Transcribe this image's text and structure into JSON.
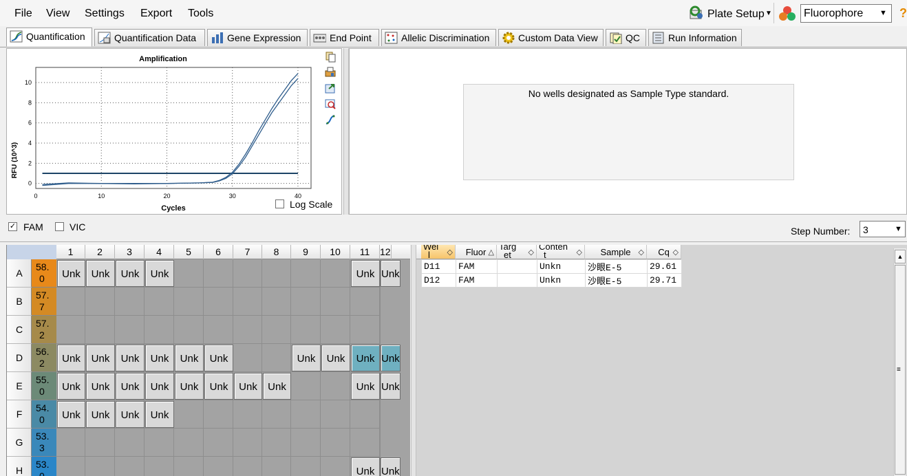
{
  "menu": [
    "File",
    "View",
    "Settings",
    "Export",
    "Tools"
  ],
  "toolbar": {
    "plate_setup": "Plate Setup",
    "fluorophore": "Fluorophore",
    "help": "?"
  },
  "tabs": [
    "Quantification",
    "Quantification Data",
    "Gene Expression",
    "End Point",
    "Allelic Discrimination",
    "Custom Data View",
    "QC",
    "Run Information"
  ],
  "std_message": "No wells designated as Sample Type standard.",
  "log_scale": "Log Scale",
  "fluors": {
    "fam": "FAM",
    "vic": "VIC"
  },
  "step": {
    "label": "Step Number:",
    "value": "3"
  },
  "plate": {
    "cols": [
      "1",
      "2",
      "3",
      "4",
      "5",
      "6",
      "7",
      "8",
      "9",
      "10",
      "11",
      "12"
    ],
    "rows": [
      "A",
      "B",
      "C",
      "D",
      "E",
      "F",
      "G",
      "H"
    ],
    "temps": [
      [
        "58.",
        "0"
      ],
      [
        "57.",
        "7"
      ],
      [
        "57.",
        "2"
      ],
      [
        "56.",
        "2"
      ],
      [
        "55.",
        "0"
      ],
      [
        "54.",
        "0"
      ],
      [
        "53.",
        "3"
      ],
      [
        "53.",
        "0"
      ]
    ],
    "temp_colors": [
      "#e8891a",
      "#d48a24",
      "#a68a4a",
      "#8c8a62",
      "#6c8a78",
      "#4a8aa6",
      "#3a88ba",
      "#2a86c8"
    ],
    "unk_label": "Unk",
    "wells": [
      [
        1,
        1,
        1,
        1,
        0,
        0,
        0,
        0,
        0,
        0,
        1,
        1
      ],
      [
        0,
        0,
        0,
        0,
        0,
        0,
        0,
        0,
        0,
        0,
        0,
        0
      ],
      [
        0,
        0,
        0,
        0,
        0,
        0,
        0,
        0,
        0,
        0,
        0,
        0
      ],
      [
        1,
        1,
        1,
        1,
        1,
        1,
        0,
        0,
        1,
        1,
        2,
        2
      ],
      [
        1,
        1,
        1,
        1,
        1,
        1,
        1,
        1,
        0,
        0,
        1,
        1
      ],
      [
        1,
        1,
        1,
        1,
        0,
        0,
        0,
        0,
        0,
        0,
        0,
        0
      ],
      [
        0,
        0,
        0,
        0,
        0,
        0,
        0,
        0,
        0,
        0,
        0,
        0
      ],
      [
        0,
        0,
        0,
        0,
        0,
        0,
        0,
        0,
        0,
        0,
        1,
        1
      ]
    ]
  },
  "results": {
    "headers": [
      [
        "Wel",
        "l"
      ],
      [
        "Fluor",
        ""
      ],
      [
        "Targ",
        "et"
      ],
      [
        "Conten",
        "t"
      ],
      [
        "Sample",
        ""
      ],
      [
        "Cq",
        ""
      ]
    ],
    "rows": [
      [
        "D11",
        "FAM",
        "",
        "Unkn",
        "沙眼E-5",
        "29.61"
      ],
      [
        "D12",
        "FAM",
        "",
        "Unkn",
        "沙眼E-5",
        "29.71"
      ]
    ]
  },
  "chart_data": {
    "type": "line",
    "title": "Amplification",
    "xlabel": "Cycles",
    "ylabel": "RFU (10^3)",
    "xlim": [
      0,
      42
    ],
    "ylim": [
      -0.5,
      11.5
    ],
    "xticks": [
      0,
      10,
      20,
      30,
      40
    ],
    "yticks": [
      0,
      2,
      4,
      6,
      8,
      10
    ],
    "grid": true,
    "threshold": 1.0,
    "series": [
      {
        "x": [
          1,
          5,
          10,
          15,
          20,
          25,
          27,
          28,
          29,
          30,
          31,
          32,
          33,
          34,
          35,
          36,
          37,
          38,
          39,
          40
        ],
        "y": [
          -0.2,
          0.0,
          0.0,
          -0.05,
          0.0,
          0.05,
          0.12,
          0.3,
          0.6,
          1.1,
          1.9,
          2.9,
          4.0,
          5.2,
          6.3,
          7.4,
          8.4,
          9.3,
          10.2,
          10.9
        ]
      },
      {
        "x": [
          1,
          5,
          10,
          15,
          20,
          25,
          27,
          28,
          29,
          30,
          31,
          32,
          33,
          34,
          35,
          36,
          37,
          38,
          39,
          40
        ],
        "y": [
          -0.1,
          0.05,
          0.0,
          0.0,
          0.0,
          0.05,
          0.1,
          0.25,
          0.5,
          0.95,
          1.7,
          2.6,
          3.7,
          4.8,
          5.9,
          7.0,
          7.9,
          8.8,
          9.7,
          10.4
        ]
      }
    ],
    "colors": {
      "line": "#2f5d8c",
      "threshold": "#1d4466"
    }
  }
}
